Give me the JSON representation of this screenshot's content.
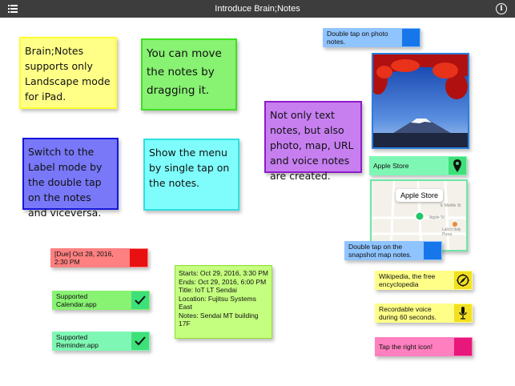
{
  "header": {
    "title": "Introduce Brain;Notes",
    "info_icon": "i"
  },
  "colors": {
    "yellow": "#ffff88",
    "green": "#88f272",
    "blue": "#7878f8",
    "cyan": "#7ffdfd",
    "purple": "#c77ff0",
    "red_status": "#e81010",
    "blue_status": "#1777ea",
    "check_green": "#3ee07a",
    "pink": "#ff7fbf",
    "magenta": "#e8177a"
  },
  "notes": {
    "landscape": "Brain;Notes supports only Landscape mode for iPad.",
    "move": "You can move the notes by dragging it.",
    "label_mode": "Switch to the Label mode by the double tap on the notes and viceversa.",
    "menu": "Show the menu by single tap on the notes.",
    "types": "Not only text notes, but also photo, map, URL and voice notes are created.",
    "photo_tap": "Double tap on photo notes.",
    "apple_store": "Apple Store",
    "map_callout": "Apple Store",
    "map_tap": "Double tap on the snapshot map notes.",
    "due": "[Due] Oct 28, 2016, 2:30 PM",
    "calendar": "Supported Calendar.app",
    "reminder": "Supported Reminder.app",
    "wikipedia": "Wikipedia, the free encyclopedia",
    "voice": "Recordable voice during 60 seconds.",
    "tap_right": "Tap the right icon!",
    "event": {
      "starts": "Starts: Oct 29, 2016, 3:30 PM",
      "ends": "Ends: Oct 29, 2016, 6:00 PM",
      "title": "Title: IoT LT Sendai",
      "location": "Location: Fujitsu Systems East",
      "notes": "Notes: Sendai MT building 17F"
    }
  },
  "map_labels": {
    "street1": "Apple St",
    "street2": "E Middle St",
    "poi": "Lalo's Italy Pizza"
  }
}
